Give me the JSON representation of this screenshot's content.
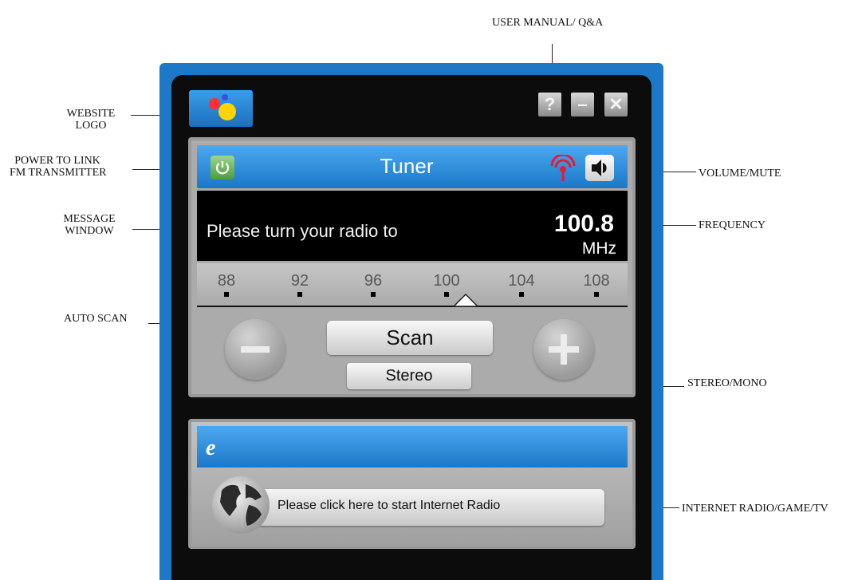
{
  "callouts": {
    "user_manual": "USER MANUAL/ Q&A",
    "website_logo": [
      "WEBSITE",
      "LOGO"
    ],
    "power_link": [
      "POWER TO LINK",
      "FM TRANSMITTER"
    ],
    "message_window": [
      "MESSAGE",
      "WINDOW"
    ],
    "auto_scan": "AUTO SCAN",
    "volume_mute": "VOLUME/MUTE",
    "frequency": "FREQUENCY",
    "stereo_mono": "STEREO/MONO",
    "internet_radio": "INTERNET RADIO/GAME/TV"
  },
  "window_controls": {
    "help": "?",
    "minimize": "–",
    "close": "✕"
  },
  "tuner": {
    "title": "Tuner",
    "message": "Please turn your radio to",
    "frequency_value": "100.8",
    "frequency_unit": "MHz",
    "scale_labels": [
      "88",
      "92",
      "96",
      "100",
      "104",
      "108"
    ],
    "scan_label": "Scan",
    "stereo_label": "Stereo"
  },
  "internet": {
    "icon_label": "e",
    "button_label": "Please click here to start Internet Radio"
  },
  "colors": {
    "frame_blue": "#1e78c8",
    "bar_blue": "#1a78c9",
    "power_green": "#4f9a3e",
    "signal_red": "#e0202a"
  },
  "icons": [
    "app-logo-icon",
    "help-icon",
    "minimize-icon",
    "close-icon",
    "power-icon",
    "signal-icon",
    "speaker-icon",
    "minus-icon",
    "plus-icon",
    "ie-icon",
    "globe-icon"
  ]
}
